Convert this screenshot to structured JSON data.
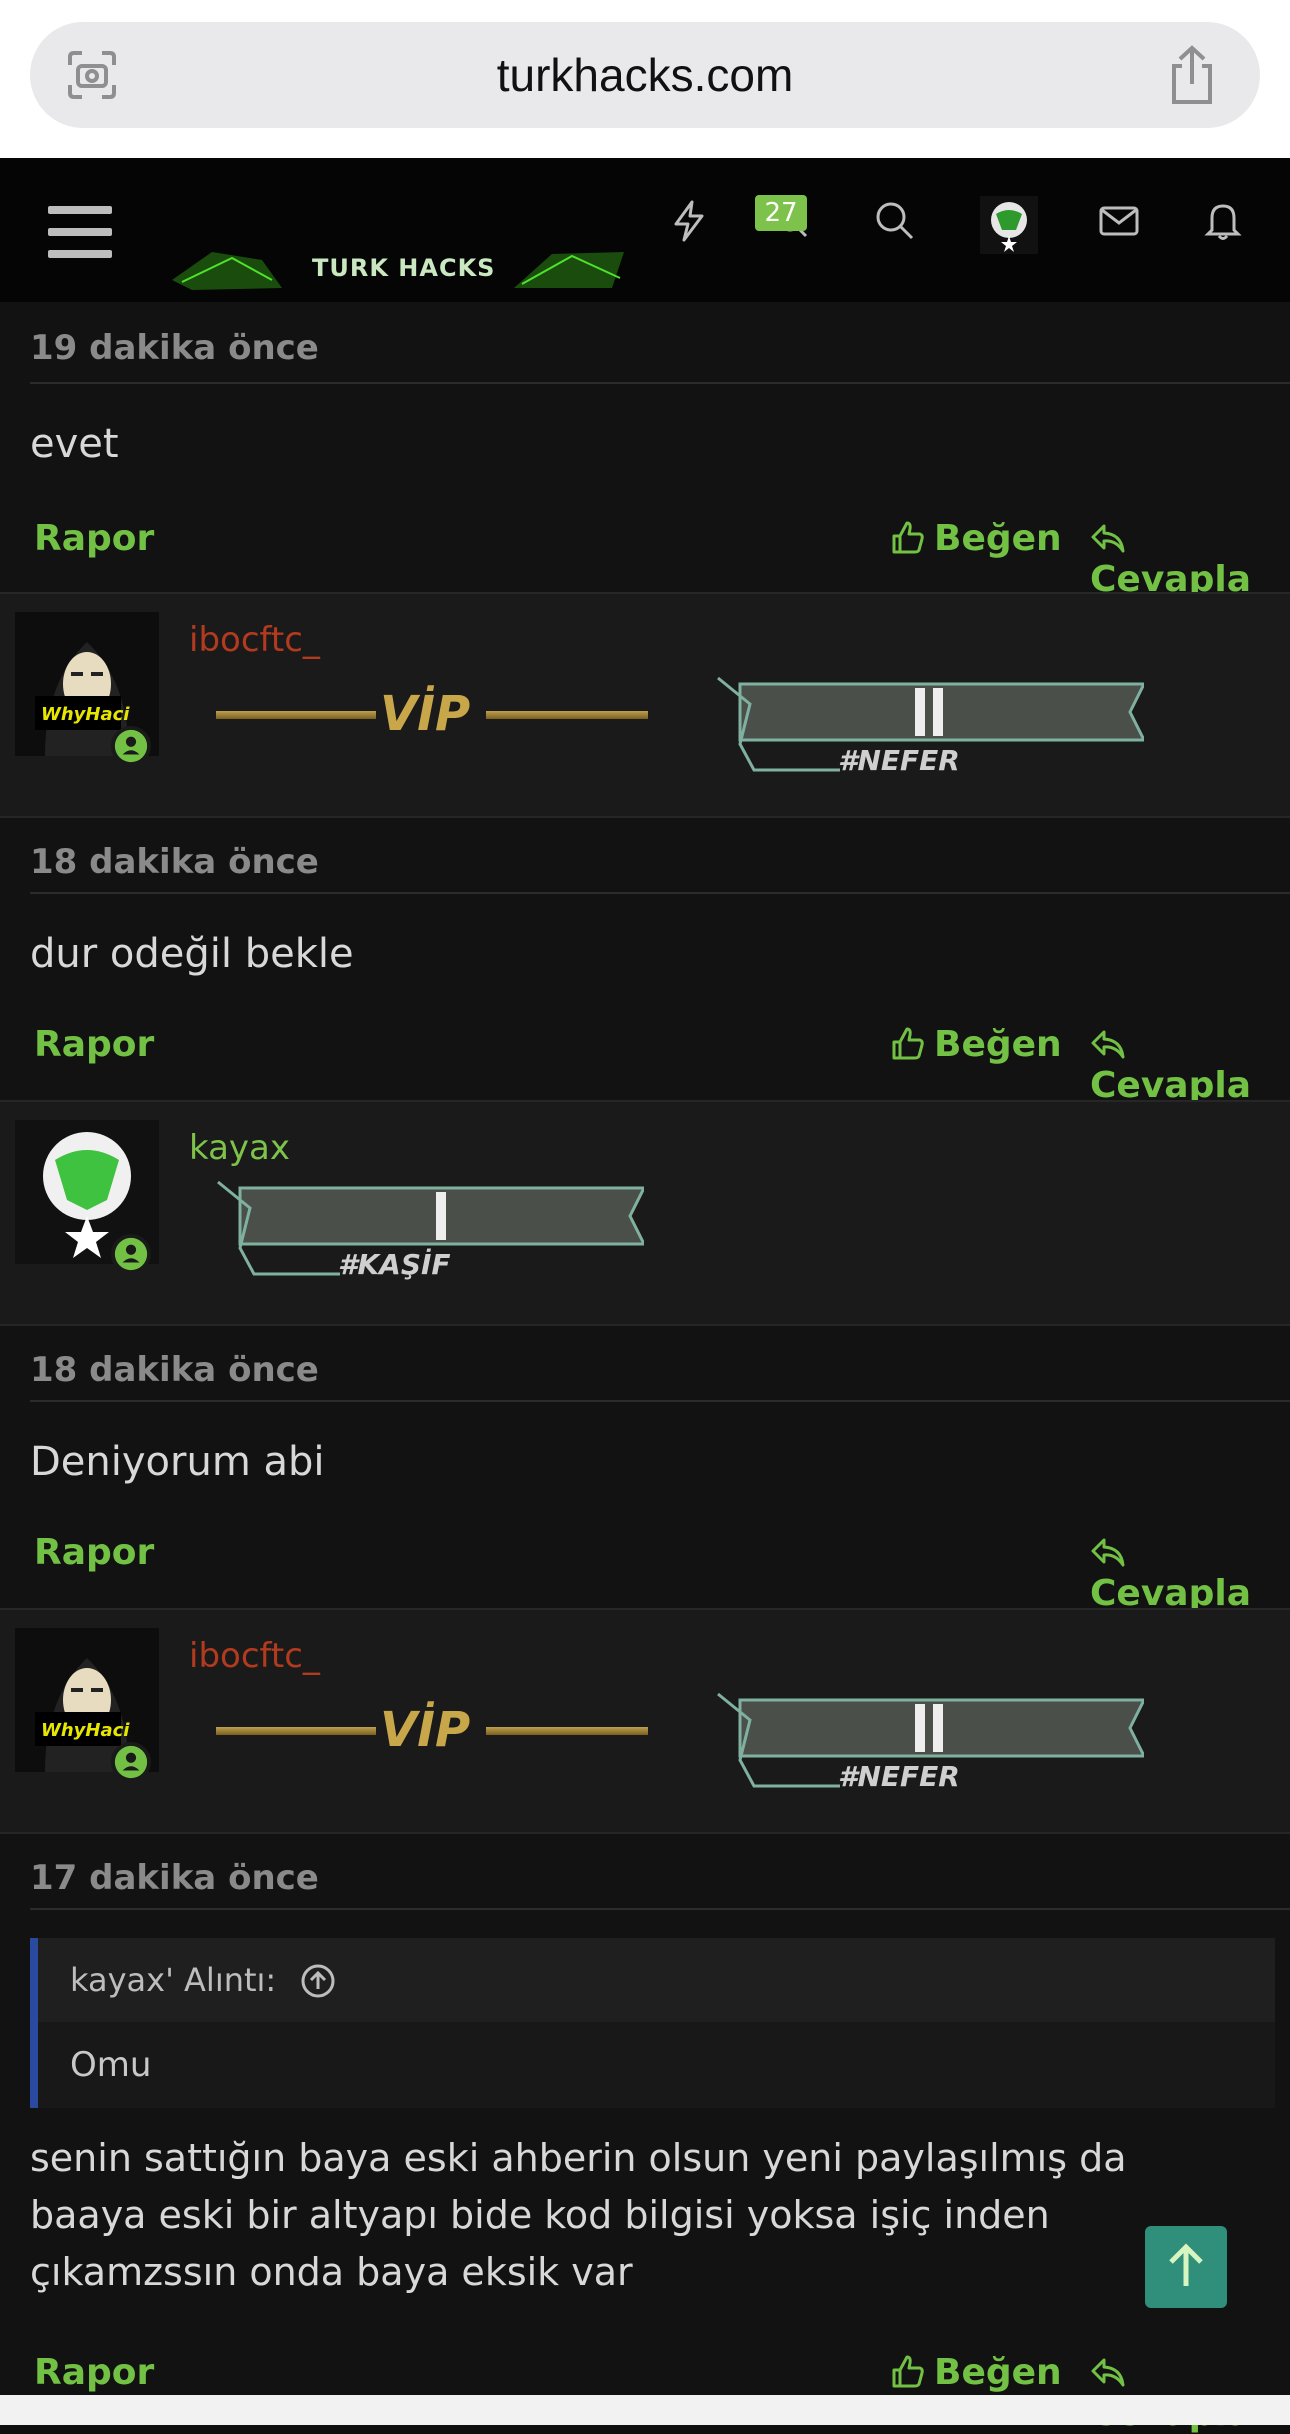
{
  "browser": {
    "url": "turkhacks.com"
  },
  "header": {
    "logo_text": "TURK HACKS",
    "notification_count": "27"
  },
  "posts": [
    {
      "time": "19 dakika önce",
      "message": "evet",
      "report_label": "Rapor",
      "like_label": "Beğen",
      "reply_label": "Cevapla"
    },
    {
      "username": "ibocftc_",
      "username_color": "#b23a1e",
      "avatar_text": "WhyHaci",
      "badges": [
        "VİP",
        "#NEFER"
      ],
      "time": "18 dakika önce",
      "message": "dur odeğil bekle",
      "report_label": "Rapor",
      "like_label": "Beğen",
      "reply_label": "Cevapla"
    },
    {
      "username": "kayax",
      "username_color": "#7dc24a",
      "badges": [
        "#KAŞİF"
      ],
      "time": "18 dakika önce",
      "message": "Deniyorum abi",
      "report_label": "Rapor",
      "reply_label": "Cevapla"
    },
    {
      "username": "ibocftc_",
      "username_color": "#b23a1e",
      "avatar_text": "WhyHaci",
      "badges": [
        "VİP",
        "#NEFER"
      ],
      "time": "17 dakika önce",
      "quote": {
        "header": "kayax' Alıntı:",
        "body": "Omu"
      },
      "message": "senin sattığın baya eski ahberin olsun yeni paylaşılmış da baaya eski bir altyapı bide kod bilgisi yoksa işiç inden çıkamzssın onda baya eksik var",
      "report_label": "Rapor",
      "like_label": "Beğen",
      "reply_label": "Cevapla"
    }
  ],
  "colors": {
    "accent_green": "#72c144",
    "background": "#121212",
    "user_block": "#1a1a1a"
  }
}
